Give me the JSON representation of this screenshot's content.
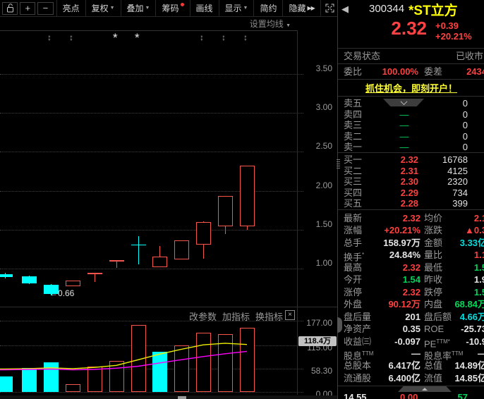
{
  "toolbar": {
    "zoom_in": "+",
    "zoom_out": "−",
    "caret": "▼",
    "more": "▶▶",
    "items": [
      {
        "label": "亮点"
      },
      {
        "label": "复权"
      },
      {
        "label": "叠加"
      },
      {
        "label": "筹码"
      },
      {
        "label": "画线"
      },
      {
        "label": "显示"
      },
      {
        "label": "简约"
      },
      {
        "label": "隐藏"
      }
    ]
  },
  "chart_header": {
    "ma_settings": "设置均线",
    "caret": "▼"
  },
  "volume_header": {
    "actions": [
      "改参数",
      "加指标",
      "换指标"
    ],
    "close_label": "×"
  },
  "colors": {
    "up": "#f4564d",
    "down": "#00ffff",
    "red_text": "#fc4241",
    "green_text": "#00d75a",
    "cyan_text": "#00dede",
    "yellow_name": "#ffff00",
    "ma_yellow": "#f0f000",
    "ma_magenta": "#ff00ff"
  },
  "chart_data": [
    {
      "type": "candlestick",
      "y_ticks": [
        "3.50",
        "3.00",
        "2.50",
        "2.00",
        "1.50",
        "1.00"
      ],
      "ylim": [
        0.6,
        3.9
      ],
      "grid": true,
      "annotation": {
        "text": "←0.66",
        "value": 0.66
      },
      "markers": [
        {
          "x": 72,
          "icon": "updown-arrows"
        },
        {
          "x": 103,
          "icon": "updown-arrows"
        },
        {
          "x": 165,
          "icon": "star"
        },
        {
          "x": 196,
          "icon": "star"
        },
        {
          "x": 288,
          "icon": "updown-arrows"
        },
        {
          "x": 319,
          "icon": "updown-arrows"
        },
        {
          "x": 350,
          "icon": "updown-arrows"
        }
      ],
      "candles": [
        {
          "x": 7,
          "o": 0.93,
          "c": 0.89,
          "h": 0.95,
          "l": 0.87,
          "d": "down"
        },
        {
          "x": 41,
          "o": 0.9,
          "c": 0.81,
          "h": 0.91,
          "l": 0.8,
          "d": "down"
        },
        {
          "x": 72,
          "o": 0.79,
          "c": 0.67,
          "h": 0.8,
          "l": 0.66,
          "d": "down"
        },
        {
          "x": 103,
          "o": 0.77,
          "c": 0.85,
          "h": 0.85,
          "l": 0.77,
          "d": "up"
        },
        {
          "x": 134,
          "o": 0.93,
          "c": 0.95,
          "h": 0.95,
          "l": 0.83,
          "d": "up"
        },
        {
          "x": 165,
          "o": 1.09,
          "c": 1.11,
          "h": 1.11,
          "l": 1.01,
          "d": "up"
        },
        {
          "x": 196,
          "o": 1.31,
          "c": 1.31,
          "h": 1.42,
          "l": 1.05,
          "d": "down"
        },
        {
          "x": 226,
          "o": 1.02,
          "c": 1.15,
          "h": 1.29,
          "l": 1.02,
          "d": "up"
        },
        {
          "x": 257,
          "o": 1.12,
          "c": 1.36,
          "h": 1.36,
          "l": 1.12,
          "d": "up"
        },
        {
          "x": 288,
          "o": 1.31,
          "c": 1.6,
          "h": 1.61,
          "l": 1.13,
          "d": "up"
        },
        {
          "x": 319,
          "o": 1.54,
          "c": 1.93,
          "h": 1.93,
          "l": 1.44,
          "d": "up"
        },
        {
          "x": 350,
          "o": 1.54,
          "c": 2.32,
          "h": 2.32,
          "l": 1.5,
          "d": "up"
        }
      ]
    },
    {
      "type": "bar",
      "y_ticks": [
        "177.00",
        "115.00",
        "58.30",
        "0.00"
      ],
      "badge": "118.4万",
      "bars": [
        {
          "x": 7,
          "v": 39,
          "d": "down"
        },
        {
          "x": 41,
          "v": 60,
          "d": "down"
        },
        {
          "x": 72,
          "v": 74,
          "d": "down"
        },
        {
          "x": 103,
          "v": 19,
          "d": "up"
        },
        {
          "x": 134,
          "v": 63,
          "d": "up"
        },
        {
          "x": 165,
          "v": 77,
          "d": "up"
        },
        {
          "x": 196,
          "v": 166,
          "d": "up"
        },
        {
          "x": 226,
          "v": 100,
          "d": "down"
        },
        {
          "x": 257,
          "v": 116,
          "d": "up"
        },
        {
          "x": 288,
          "v": 147,
          "d": "up"
        },
        {
          "x": 319,
          "v": 143,
          "d": "up"
        },
        {
          "x": 350,
          "v": 159,
          "d": "up"
        }
      ],
      "series": [
        {
          "name": "ma-yellow",
          "color": "#f0f000",
          "x": [
            0,
            7,
            41,
            72,
            103,
            134,
            165,
            196,
            226,
            257,
            288,
            319,
            350
          ],
          "values": [
            57,
            57,
            58,
            60,
            58,
            61,
            66,
            80,
            94,
            106,
            117,
            121,
            118
          ]
        },
        {
          "name": "ma-magenta",
          "color": "#ff00ff",
          "x": [
            0,
            7,
            41,
            72,
            103,
            134,
            165,
            196,
            226,
            257,
            288,
            319,
            350
          ],
          "values": [
            55,
            55,
            56,
            57,
            55,
            56,
            59,
            64,
            72,
            80,
            88,
            95,
            101
          ]
        }
      ]
    }
  ],
  "panel": {
    "back_icon": "◀",
    "code": "300344",
    "name": "*ST立方",
    "price": "2.32",
    "change": "+0.39",
    "change_pct": "+20.21%",
    "status_label": "交易状态",
    "status_value": "已收市",
    "weibi_label": "委比",
    "weibi_value": "100.00%",
    "weicha_label": "委差",
    "weicha_value": "2434",
    "ad_text": "抓住机会，即刻开户！",
    "sell_rows": [
      {
        "label": "卖五",
        "qty": "0"
      },
      {
        "label": "卖四",
        "qty": "0"
      },
      {
        "label": "卖三",
        "qty": "0"
      },
      {
        "label": "卖二",
        "qty": "0"
      },
      {
        "label": "卖一",
        "qty": "0"
      }
    ],
    "buy_rows": [
      {
        "label": "买一",
        "price": "2.32",
        "qty": "16768"
      },
      {
        "label": "买二",
        "price": "2.31",
        "qty": "4125"
      },
      {
        "label": "买三",
        "price": "2.30",
        "qty": "2320"
      },
      {
        "label": "买四",
        "price": "2.29",
        "qty": "734"
      },
      {
        "label": "买五",
        "price": "2.28",
        "qty": "399"
      }
    ],
    "stats": [
      {
        "l1": "最新",
        "v1": "2.32",
        "k1": "r",
        "l2": "均价",
        "v2": "2.1",
        "k2": "r"
      },
      {
        "l1": "涨幅",
        "v1": "+20.21%",
        "k1": "r",
        "l2": "涨跌",
        "v2": "▲0.3",
        "k2": "r"
      },
      {
        "l1": "总手",
        "v1": "158.97万",
        "k1": "w",
        "l2": "金额",
        "v2": "3.33亿",
        "k2": "c"
      },
      {
        "l1": "换手",
        "s1": "*",
        "v1": "24.84%",
        "k1": "w",
        "l2": "量比",
        "v2": "1.1",
        "k2": "r"
      },
      {
        "l1": "最高",
        "v1": "2.32",
        "k1": "r",
        "l2": "最低",
        "v2": "1.5",
        "k2": "g"
      },
      {
        "l1": "今开",
        "v1": "1.54",
        "k1": "g",
        "l2": "昨收",
        "v2": "1.9",
        "k2": "w"
      },
      {
        "l1": "涨停",
        "v1": "2.32",
        "k1": "r",
        "l2": "跌停",
        "v2": "1.5",
        "k2": "g"
      },
      {
        "l1": "外盘",
        "v1": "90.12万",
        "k1": "r",
        "l2": "内盘",
        "v2": "68.84万",
        "k2": "g"
      },
      {
        "l1": "盘后量",
        "v1": "201",
        "k1": "w",
        "l2": "盘后额",
        "v2": "4.66万",
        "k2": "c"
      },
      {
        "l1": "净资产",
        "v1": "0.35",
        "k1": "w",
        "l2": "ROE",
        "v2": "-25.73",
        "k2": "w"
      },
      {
        "l1": "收益㈢",
        "v1": "-0.097",
        "k1": "w",
        "l2": "PE",
        "s2": "TTM*",
        "v2": "-10.9",
        "k2": "w"
      },
      {
        "l1": "股息",
        "s1": "TTM",
        "v1": "—",
        "k1": "w",
        "l2": "股息率",
        "s2": "TTM",
        "v2": "—",
        "k2": "w"
      },
      {
        "l1": "总股本",
        "v1": "6.417亿",
        "k1": "w",
        "l2": "总值",
        "v2": "14.89亿",
        "k2": "w"
      },
      {
        "l1": "流通股",
        "v1": "6.400亿",
        "k1": "w",
        "l2": "流值",
        "v2": "14.85亿",
        "k2": "w"
      }
    ],
    "ticker_row": {
      "time": "14.55",
      "price": "0.00",
      "vol": "57"
    }
  }
}
